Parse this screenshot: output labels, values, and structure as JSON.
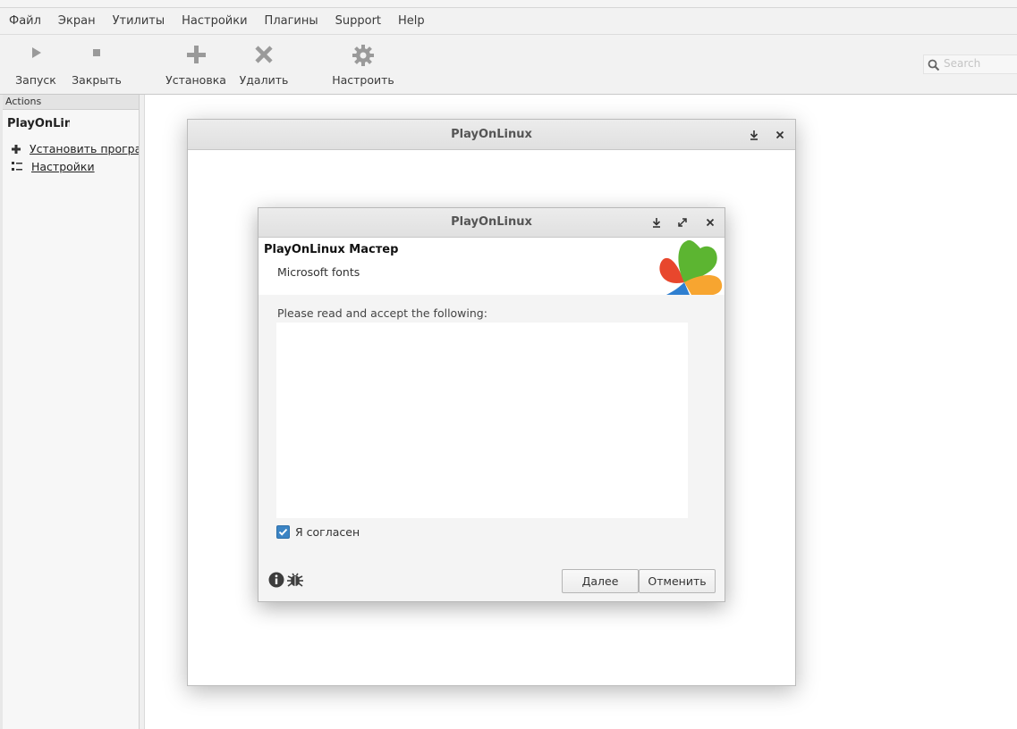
{
  "menubar": {
    "items": [
      "Файл",
      "Экран",
      "Утилиты",
      "Настройки",
      "Плагины",
      "Support",
      "Help"
    ]
  },
  "toolbar": {
    "run_label": "Запуск",
    "close_label": "Закрыть",
    "install_label": "Установка",
    "remove_label": "Удалить",
    "configure_label": "Настроить",
    "search_placeholder": "Search"
  },
  "sidebar": {
    "header": "Actions",
    "title": "PlayOnLinux",
    "items": [
      {
        "label": "Установить программу",
        "icon": "plus-icon"
      },
      {
        "label": "Настройки",
        "icon": "settings-list-icon"
      }
    ]
  },
  "outer_dialog": {
    "title": "PlayOnLinux"
  },
  "wizard": {
    "title": "PlayOnLinux",
    "heading": "PlayOnLinux Мастер",
    "subheading": "Microsoft fonts",
    "prompt": "Please read and accept the following:",
    "license_text": "",
    "agree_label": "Я согласен",
    "agree_checked": true,
    "next_label": "Далее",
    "cancel_label": "Отменить"
  },
  "colors": {
    "checkbox": "#3b84c4",
    "logo_green": "#5cb531",
    "logo_red": "#e8472d",
    "logo_orange": "#f7a530",
    "logo_blue": "#2f7fd0"
  }
}
